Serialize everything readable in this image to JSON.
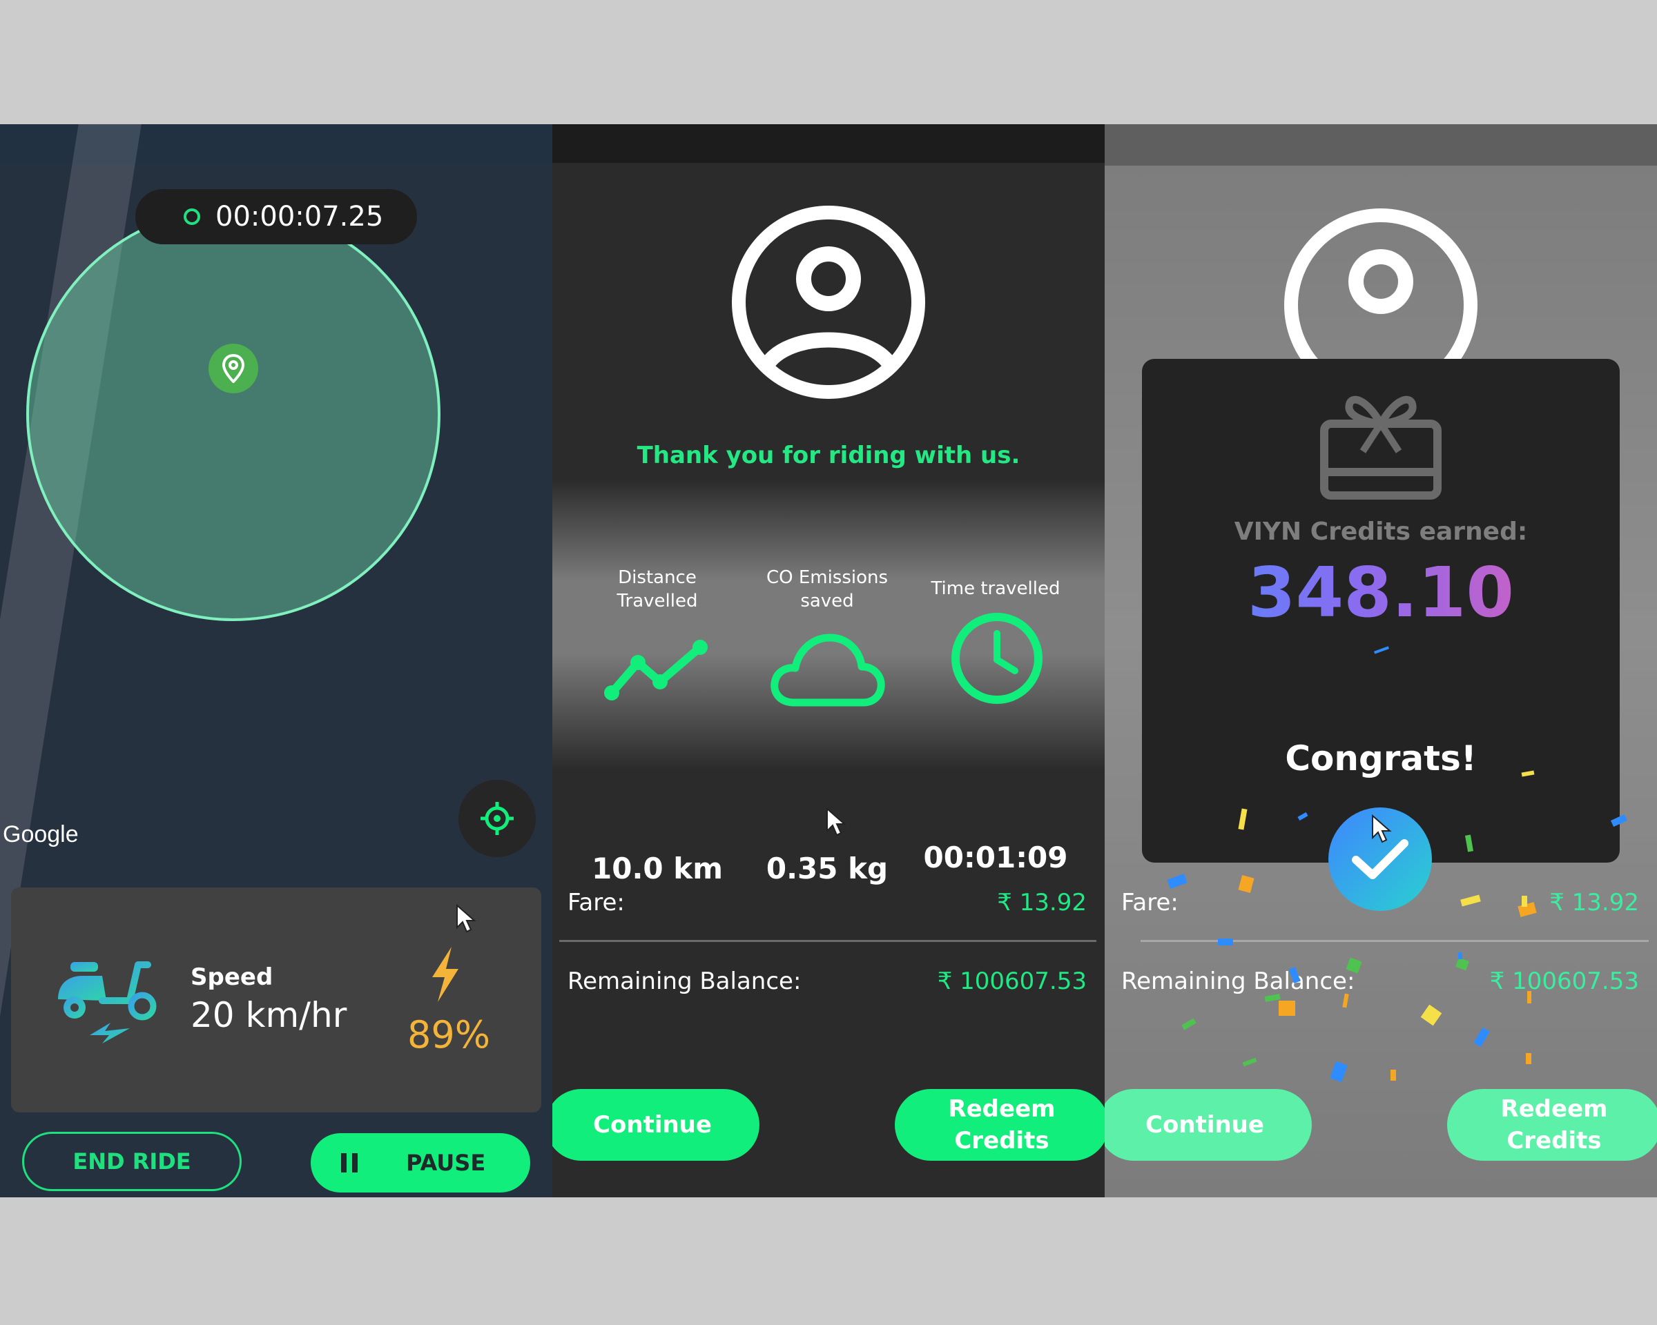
{
  "screen1": {
    "timer": "00:00:07.25",
    "map_attribution": "Google",
    "speed_label": "Speed",
    "speed_value": "20 km/hr",
    "battery": "89%",
    "end_ride_label": "END RIDE",
    "pause_label": "PAUSE"
  },
  "screen2": {
    "thank_you": "Thank you for riding with us.",
    "stats": [
      {
        "label_line1": "Distance",
        "label_line2": "Travelled",
        "value": "10.0 km",
        "icon": "distance-icon"
      },
      {
        "label_line1": "CO Emissions",
        "label_line2": "saved",
        "value": "0.35 kg",
        "icon": "cloud-icon"
      },
      {
        "label_line1": "Time travelled",
        "label_line2": "",
        "value": "00:01:09",
        "icon": "clock-icon"
      }
    ],
    "fare_label": "Fare:",
    "fare_value": "₹ 13.92",
    "balance_label": "Remaining Balance:",
    "balance_value": "₹ 100607.53",
    "continue_label": "Continue",
    "redeem_line1": "Redeem",
    "redeem_line2": "Credits"
  },
  "screen3": {
    "credits_label": "VIYN Credits earned:",
    "credits_value": "348.10",
    "congrats": "Congrats!",
    "fare_label": "Fare:",
    "fare_value": "₹ 13.92",
    "balance_label": "Remaining Balance:",
    "balance_value": "₹ 100607.53",
    "continue_label": "Continue",
    "redeem_line1": "Redeem",
    "redeem_line2": "Credits"
  },
  "colors": {
    "accent_green": "#12ee7c",
    "battery_yellow": "#f4b43a",
    "map_background": "#26313f"
  }
}
